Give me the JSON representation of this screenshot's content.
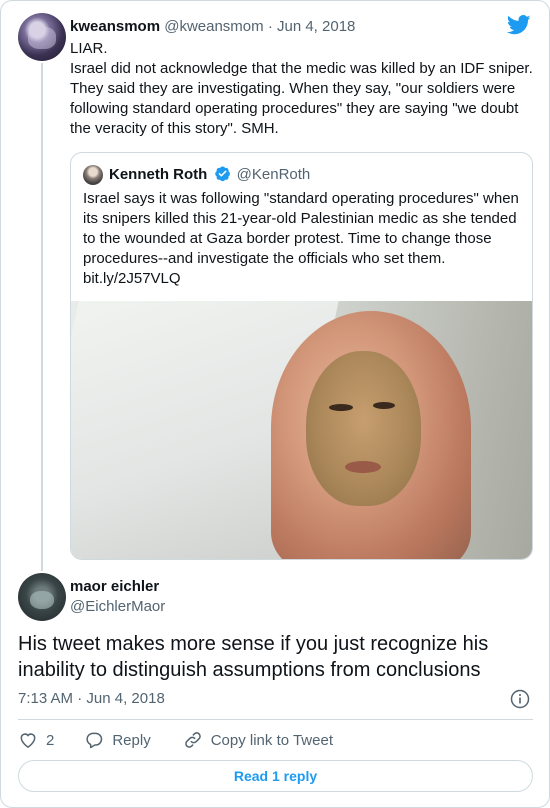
{
  "quoting_tweet": {
    "author_name": "kweansmom",
    "author_handle": "@kweansmom",
    "separator": "·",
    "date": "Jun 4, 2018",
    "lines": [
      "LIAR.",
      "Israel did not acknowledge that the medic was killed by an IDF sniper. They said they are investigating. When they say, \"our soldiers were following standard operating procedures\" they are saying \"we doubt the veracity of this story\". SMH."
    ]
  },
  "quoted_tweet": {
    "author_name": "Kenneth Roth",
    "author_handle": "@KenRoth",
    "text": "Israel says it was following \"standard operating procedures\" when its snipers killed this 21-year-old Palestinian medic as she tended to the wounded at Gaza border protest. Time to change those procedures--and investigate the officials who set them.",
    "link": "bit.ly/2J57VLQ"
  },
  "main_tweet": {
    "author_name": "maor eichler",
    "author_handle": "@EichlerMaor",
    "text": "His tweet makes more sense if you just recognize his inability to distinguish assumptions from conclusions",
    "time": "7:13 AM",
    "separator": "·",
    "date": "Jun 4, 2018"
  },
  "actions": {
    "like_count": "2",
    "reply_label": "Reply",
    "copy_link_label": "Copy link to Tweet"
  },
  "read_replies_label": "Read 1 reply",
  "colors": {
    "accent": "#1d9bf0",
    "verified": "#1d9bf0",
    "secondary_text": "#536471",
    "border": "#cfd9de"
  },
  "icons": [
    "twitter-bird-icon",
    "verified-badge-icon",
    "info-icon",
    "heart-icon",
    "reply-icon",
    "link-icon"
  ]
}
